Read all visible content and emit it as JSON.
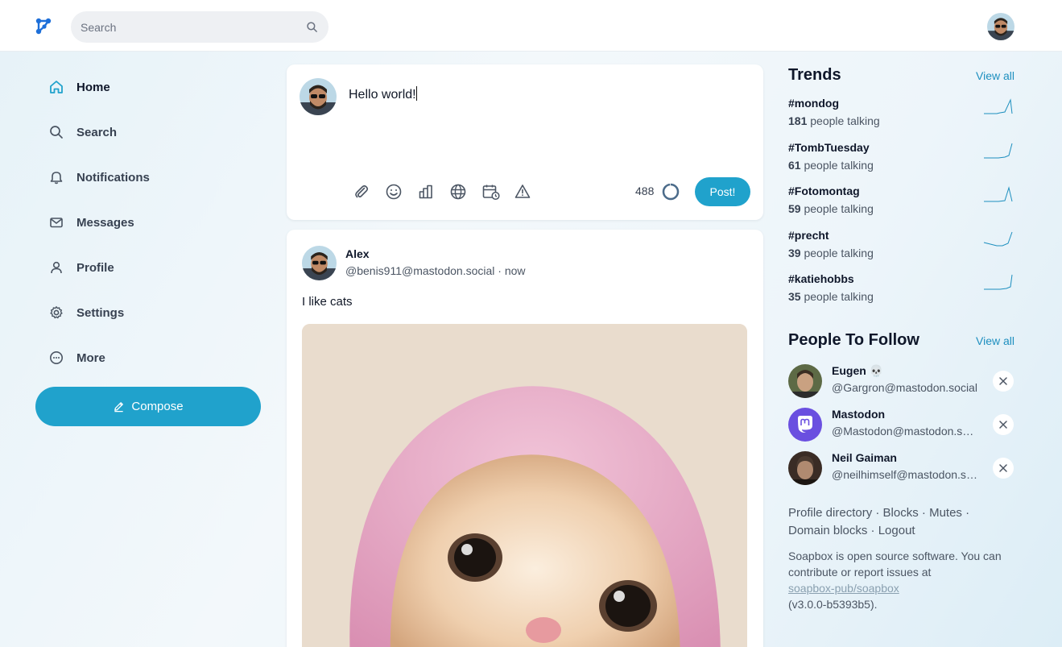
{
  "topbar": {
    "search_placeholder": "Search",
    "logo_icon": "soapbox-logo-icon",
    "accent": "#20a2cc"
  },
  "nav": {
    "items": [
      {
        "label": "Home",
        "icon": "home-icon"
      },
      {
        "label": "Search",
        "icon": "search-icon"
      },
      {
        "label": "Notifications",
        "icon": "bell-icon"
      },
      {
        "label": "Messages",
        "icon": "mail-icon"
      },
      {
        "label": "Profile",
        "icon": "user-icon"
      },
      {
        "label": "Settings",
        "icon": "gear-icon"
      },
      {
        "label": "More",
        "icon": "dots-circle-icon"
      }
    ],
    "compose_label": "Compose"
  },
  "composer": {
    "text": "Hello world!",
    "char_count": "488",
    "post_label": "Post!"
  },
  "status": {
    "display_name": "Alex",
    "meta": "@benis911@mastodon.social · now",
    "body": "I like cats"
  },
  "trends": {
    "title": "Trends",
    "view_all": "View all",
    "items": [
      {
        "tag": "#mondog",
        "count": "181",
        "suffix": "people talking"
      },
      {
        "tag": "#TombTuesday",
        "count": "61",
        "suffix": "people talking"
      },
      {
        "tag": "#Fotomontag",
        "count": "59",
        "suffix": "people talking"
      },
      {
        "tag": "#precht",
        "count": "39",
        "suffix": "people talking"
      },
      {
        "tag": "#katiehobbs",
        "count": "35",
        "suffix": "people talking"
      }
    ]
  },
  "follow": {
    "title": "People To Follow",
    "view_all": "View all",
    "items": [
      {
        "name": "Eugen 💀",
        "handle": "@Gargron@mastodon.social"
      },
      {
        "name": "Mastodon",
        "handle": "@Mastodon@mastodon.social"
      },
      {
        "name": "Neil Gaiman",
        "handle": "@neilhimself@mastodon.social"
      }
    ]
  },
  "footer": {
    "l1": "Profile directory",
    "l2": "Blocks",
    "l3": "Mutes",
    "l4": "Domain blocks",
    "l5": "Logout",
    "sep": " · ",
    "about_pre": "Soapbox is open source software. You can contribute or report issues at",
    "about_repo": "soapbox-pub/soapbox",
    "about_version": "(v3.0.0-b5393b5)."
  }
}
